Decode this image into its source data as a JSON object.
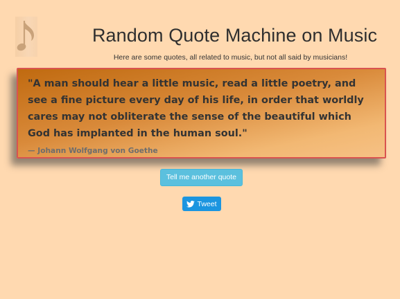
{
  "header": {
    "logo_icon": "music-note-icon",
    "title": "Random Quote Machine on Music",
    "subtitle": "Here are some quotes, all related to music, but not all said by musicians!"
  },
  "quote": {
    "text": "\"A man should hear a little music, read a little poetry, and see a fine picture every day of his life, in order that worldly cares may not obliterate the sense of the beautiful which God has implanted in the human soul.\"",
    "author": "— Johann Wolfgang von Goethe"
  },
  "actions": {
    "another_quote_label": "Tell me another quote",
    "tweet_label": "Tweet",
    "tweet_icon": "twitter-bird-icon"
  },
  "colors": {
    "background": "#ffd9b0",
    "quote_border": "#d9534f",
    "quote_gradient_start": "#c06a10",
    "quote_gradient_end": "#f6c185",
    "info_button": "#5bc0de",
    "tweet_button": "#1b95e0"
  }
}
